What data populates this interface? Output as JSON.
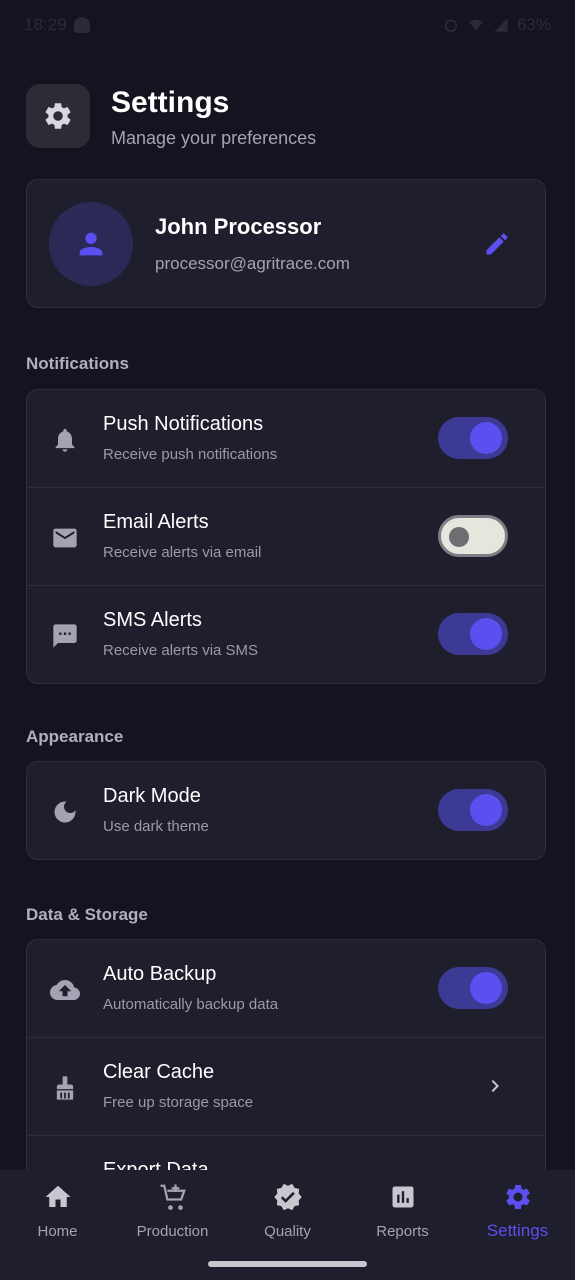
{
  "status_bar": {
    "time": "18:29",
    "battery": "63%"
  },
  "header": {
    "title": "Settings",
    "subtitle": "Manage your preferences"
  },
  "profile": {
    "name": "John Processor",
    "email": "processor@agritrace.com"
  },
  "sections": {
    "notifications": {
      "title": "Notifications",
      "push": {
        "title": "Push Notifications",
        "subtitle": "Receive push notifications",
        "enabled": true
      },
      "email": {
        "title": "Email Alerts",
        "subtitle": "Receive alerts via email",
        "enabled": false
      },
      "sms": {
        "title": "SMS Alerts",
        "subtitle": "Receive alerts via SMS",
        "enabled": true
      }
    },
    "appearance": {
      "title": "Appearance",
      "dark_mode": {
        "title": "Dark Mode",
        "subtitle": "Use dark theme",
        "enabled": true
      }
    },
    "data_storage": {
      "title": "Data & Storage",
      "auto_backup": {
        "title": "Auto Backup",
        "subtitle": "Automatically backup data",
        "enabled": true
      },
      "clear_cache": {
        "title": "Clear Cache",
        "subtitle": "Free up storage space"
      },
      "export_data": {
        "title": "Export Data"
      }
    }
  },
  "bottom_nav": [
    {
      "label": "Home",
      "icon": "home-icon"
    },
    {
      "label": "Production",
      "icon": "cart-icon"
    },
    {
      "label": "Quality",
      "icon": "verified-icon"
    },
    {
      "label": "Reports",
      "icon": "report-icon"
    },
    {
      "label": "Settings",
      "icon": "gear-icon",
      "active": true
    }
  ],
  "colors": {
    "accent": "#5b4ff0",
    "background": "#14131f",
    "card": "#1f1e2c"
  }
}
